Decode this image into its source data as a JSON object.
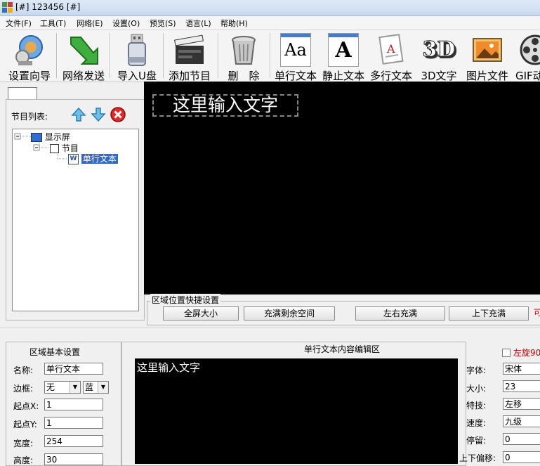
{
  "window": {
    "title": "[#] 123456 [#]"
  },
  "menu": [
    "文件(F)",
    "工具(T)",
    "网络(E)",
    "设置(O)",
    "预览(S)",
    "语言(L)",
    "帮助(H)"
  ],
  "toolbar": {
    "items": [
      {
        "label": "设置向导",
        "icon": "wizard-icon"
      },
      {
        "label": "网络发送",
        "icon": "download-arrow-icon"
      },
      {
        "label": "导入U盘",
        "icon": "usb-drive-icon"
      },
      {
        "label": "添加节目",
        "icon": "clapperboard-icon"
      },
      {
        "label": "删　除",
        "icon": "trash-bin-icon"
      },
      {
        "label": "单行文本",
        "icon": "single-text-icon"
      },
      {
        "label": "静止文本",
        "icon": "static-text-icon"
      },
      {
        "label": "多行文本",
        "icon": "multiline-text-icon"
      },
      {
        "label": "3D文字",
        "icon": "3d-text-icon"
      },
      {
        "label": "图片文件",
        "icon": "picture-icon"
      },
      {
        "label": "GIF动",
        "icon": "film-reel-icon"
      }
    ],
    "icon_text": {
      "aa": "Aa",
      "a": "A",
      "three_d": "3D"
    }
  },
  "program_list": {
    "label": "节目列表:",
    "tree": {
      "screen": "显示屏",
      "program": "节目",
      "item": "单行文本"
    }
  },
  "preview": {
    "text": "这里输入文字"
  },
  "quick_settings": {
    "title": "区域位置快捷设置",
    "buttons": [
      "全屏大小",
      "充满剩余空间",
      "左右充满",
      "上下充满"
    ],
    "extra": "可"
  },
  "basic_settings": {
    "title": "区域基本设置",
    "name_label": "名称:",
    "name_value": "单行文本",
    "border_label": "边框:",
    "border_value": "无",
    "border_color": "蓝",
    "startx_label": "起点X:",
    "startx_value": "1",
    "starty_label": "起点Y:",
    "starty_value": "1",
    "width_label": "宽度:",
    "width_value": "254",
    "height_label": "高度:",
    "height_value": "30"
  },
  "editor": {
    "title": "单行文本内容编辑区",
    "content": "这里输入文字"
  },
  "text_props": {
    "rotate_label": "左旋90",
    "font_label": "字体:",
    "font_value": "宋体",
    "size_label": "大小:",
    "size_value": "23",
    "effect_label": "特技:",
    "effect_value": "左移",
    "speed_label": "速度:",
    "speed_value": "九级",
    "stay_label": "停留:",
    "stay_value": "0",
    "offset_label": "上下偏移:",
    "offset_value": "0"
  }
}
